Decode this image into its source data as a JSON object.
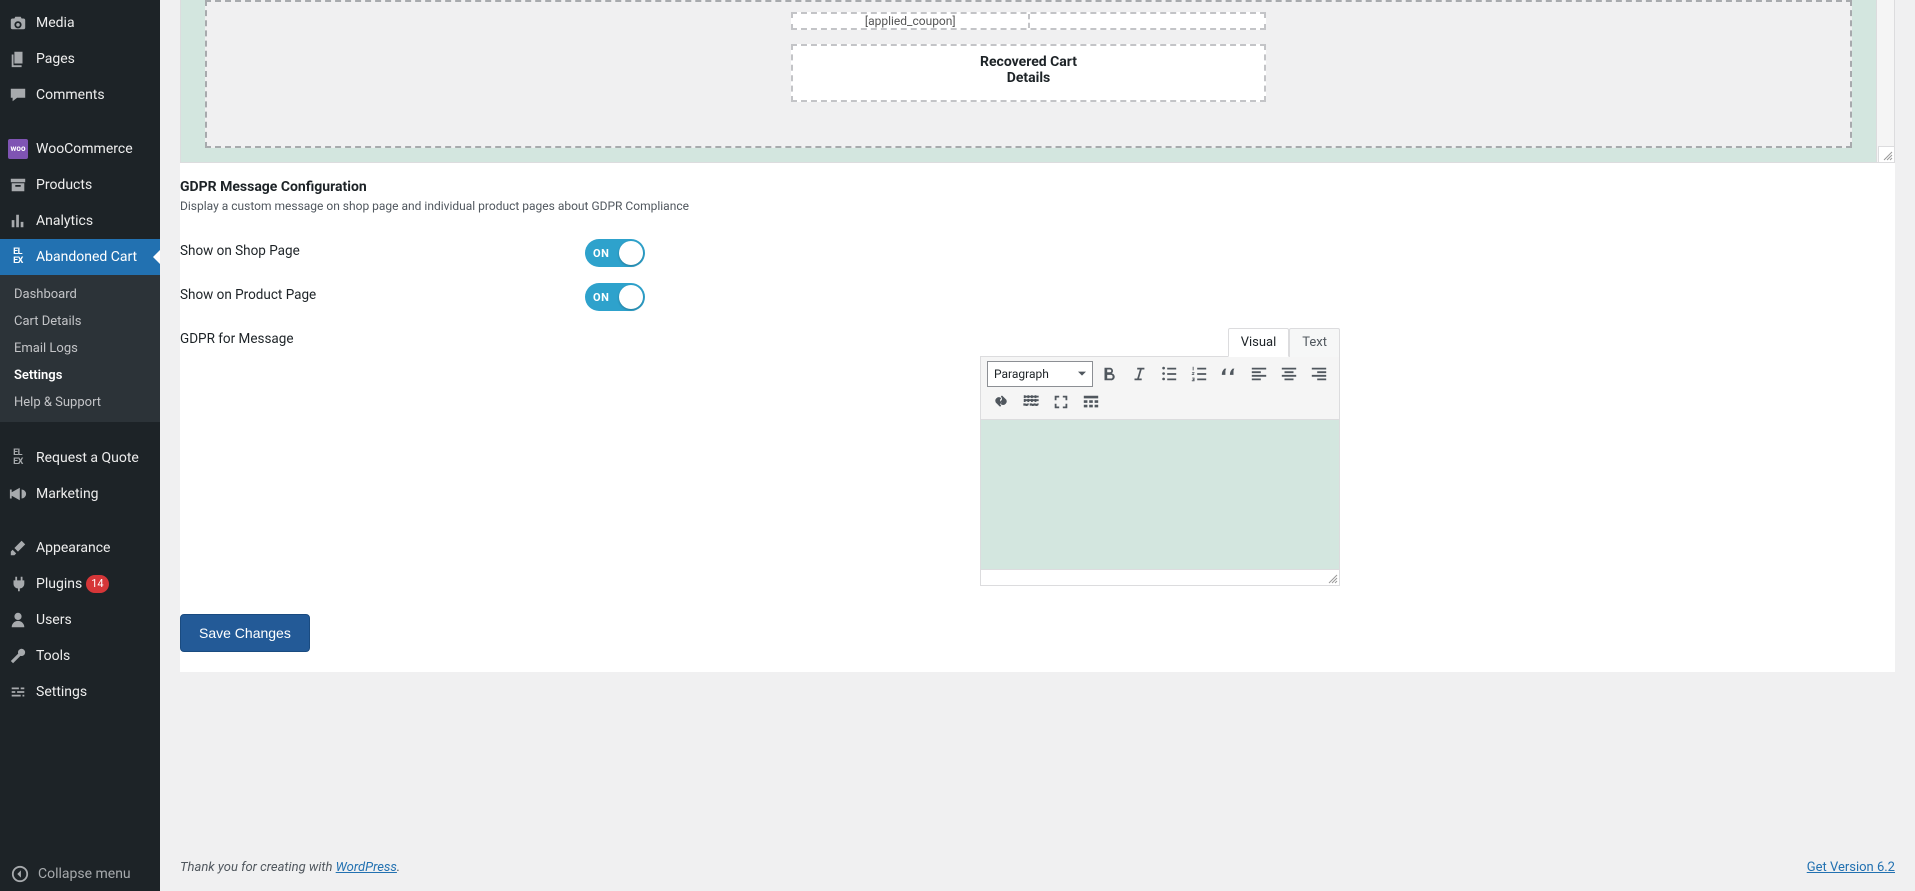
{
  "sidebar": {
    "items": [
      {
        "id": "media",
        "label": "Media",
        "icon": "camera"
      },
      {
        "id": "pages",
        "label": "Pages",
        "icon": "copy"
      },
      {
        "id": "comments",
        "label": "Comments",
        "icon": "chat"
      },
      {
        "id": "sep"
      },
      {
        "id": "woocommerce",
        "label": "WooCommerce",
        "icon": "woo"
      },
      {
        "id": "products",
        "label": "Products",
        "icon": "archive"
      },
      {
        "id": "analytics",
        "label": "Analytics",
        "icon": "bars"
      },
      {
        "id": "abandoned",
        "label": "Abandoned Cart",
        "icon": "elex",
        "active": true,
        "submenu": [
          {
            "id": "dashboard",
            "label": "Dashboard"
          },
          {
            "id": "cart-details",
            "label": "Cart Details"
          },
          {
            "id": "email-logs",
            "label": "Email Logs"
          },
          {
            "id": "settings",
            "label": "Settings",
            "current": true
          },
          {
            "id": "help",
            "label": "Help & Support"
          }
        ]
      },
      {
        "id": "sep"
      },
      {
        "id": "quote",
        "label": "Request a Quote",
        "icon": "elex"
      },
      {
        "id": "marketing",
        "label": "Marketing",
        "icon": "megaphone"
      },
      {
        "id": "sep"
      },
      {
        "id": "appearance",
        "label": "Appearance",
        "icon": "brush"
      },
      {
        "id": "plugins",
        "label": "Plugins",
        "icon": "plug",
        "badge": "14"
      },
      {
        "id": "users",
        "label": "Users",
        "icon": "user"
      },
      {
        "id": "tools",
        "label": "Tools",
        "icon": "wrench"
      },
      {
        "id": "settings",
        "label": "Settings",
        "icon": "sliders"
      }
    ],
    "collapse_label": "Collapse menu"
  },
  "template_preview": {
    "top_fragment": "[applied_coupon]",
    "block_title_line1": "Recovered Cart",
    "block_title_line2": "Details"
  },
  "gdpr": {
    "heading": "GDPR Message Configuration",
    "description": "Display a custom message on shop page and individual product pages about GDPR Compliance",
    "show_shop_label": "Show on Shop Page",
    "show_shop_on": "ON",
    "show_product_label": "Show on Product Page",
    "show_product_on": "ON",
    "message_label": "GDPR for Message"
  },
  "editor": {
    "tabs": {
      "visual": "Visual",
      "text": "Text"
    },
    "format_select": "Paragraph",
    "buttons_row1": [
      {
        "id": "bold",
        "label": "Bold",
        "icon": "bold"
      },
      {
        "id": "italic",
        "label": "Italic",
        "icon": "italic"
      },
      {
        "id": "ul",
        "label": "Bulleted list",
        "icon": "ul"
      },
      {
        "id": "ol",
        "label": "Numbered list",
        "icon": "ol"
      },
      {
        "id": "quote",
        "label": "Blockquote",
        "icon": "quote"
      },
      {
        "id": "alignl",
        "label": "Align left",
        "icon": "alignl"
      },
      {
        "id": "alignc",
        "label": "Align center",
        "icon": "alignc"
      }
    ],
    "buttons_row2": [
      {
        "id": "alignr",
        "label": "Align right",
        "icon": "alignr"
      },
      {
        "id": "link",
        "label": "Insert link",
        "icon": "link"
      },
      {
        "id": "more",
        "label": "Read more",
        "icon": "more"
      },
      {
        "id": "full",
        "label": "Fullscreen",
        "icon": "full"
      },
      {
        "id": "kitchen",
        "label": "Toolbar toggle",
        "icon": "kitchen"
      }
    ]
  },
  "save_label": "Save Changes",
  "footer": {
    "thanks_prefix": "Thank you for creating with ",
    "wp_link": "WordPress",
    "period": ".",
    "version_link": "Get Version 6.2"
  }
}
